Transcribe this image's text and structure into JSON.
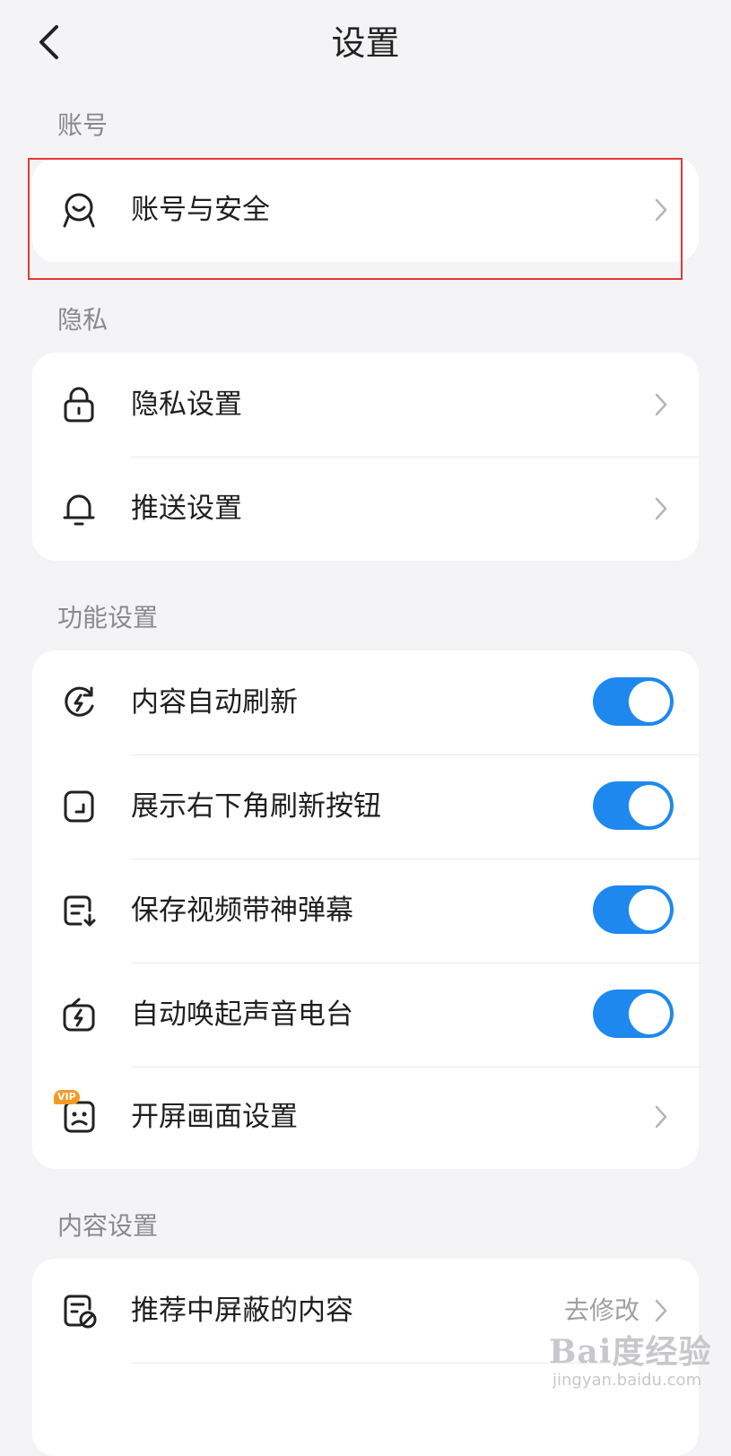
{
  "header": {
    "title": "设置"
  },
  "sections": {
    "account": {
      "label": "账号",
      "items": [
        {
          "label": "账号与安全"
        }
      ]
    },
    "privacy": {
      "label": "隐私",
      "items": [
        {
          "label": "隐私设置"
        },
        {
          "label": "推送设置"
        }
      ]
    },
    "features": {
      "label": "功能设置",
      "items": [
        {
          "label": "内容自动刷新",
          "enabled": true
        },
        {
          "label": "展示右下角刷新按钮",
          "enabled": true
        },
        {
          "label": "保存视频带神弹幕",
          "enabled": true
        },
        {
          "label": "自动唤起声音电台",
          "enabled": true
        },
        {
          "label": "开屏画面设置",
          "badge": "VIP"
        }
      ]
    },
    "content": {
      "label": "内容设置",
      "items": [
        {
          "label": "推荐中屏蔽的内容",
          "value": "去修改"
        }
      ]
    }
  },
  "watermark": {
    "logo": "Bai度经验",
    "url": "jingyan.baidu.com"
  },
  "colors": {
    "accent": "#1e88ee",
    "highlight": "#e53935",
    "vip": "#f29a24",
    "background": "#f4f4f6"
  }
}
